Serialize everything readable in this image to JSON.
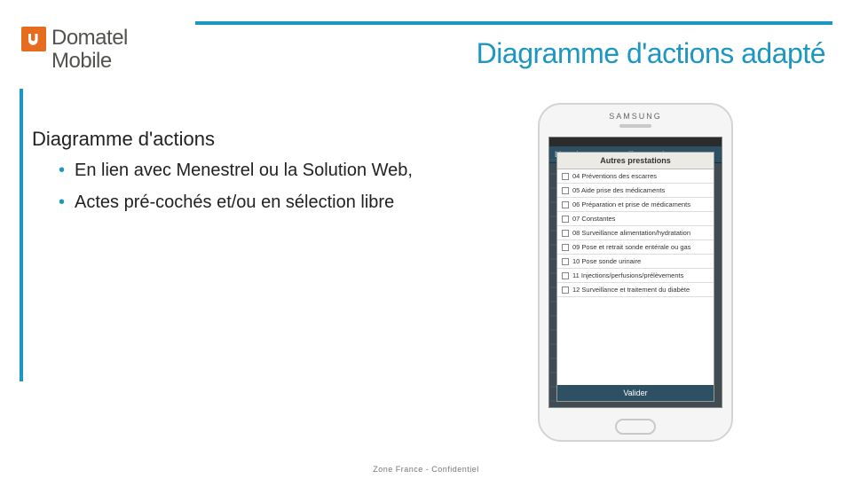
{
  "header": {
    "brand_line1": "Domatel",
    "brand_line2": "Mobile",
    "slide_title": "Diagramme d'actions adapté"
  },
  "content": {
    "subtitle": "Diagramme d'actions",
    "bullets": [
      "En lien avec Menestrel ou la Solution Web,",
      "Actes pré-cochés et/ou en sélection libre"
    ]
  },
  "phone": {
    "maker": "SAMSUNG",
    "app_title": "Liste des actes pour l'intervention",
    "dialog_header": "Autres prestations",
    "items": [
      "04 Préventions des escarres",
      "05 Aide prise des médicaments",
      "06 Préparation et prise de médicaments",
      "07 Constantes",
      "08 Surveillance alimentation/hydratation",
      "09 Pose et retrait sonde entérale ou gas",
      "10 Pose sonde urinaire",
      "11 Injections/perfusions/prélèvements",
      "12 Surveillance et traitement du diabète"
    ],
    "footer_button": "Valider"
  },
  "footer": {
    "text": "Zone France - Confidentiel"
  }
}
